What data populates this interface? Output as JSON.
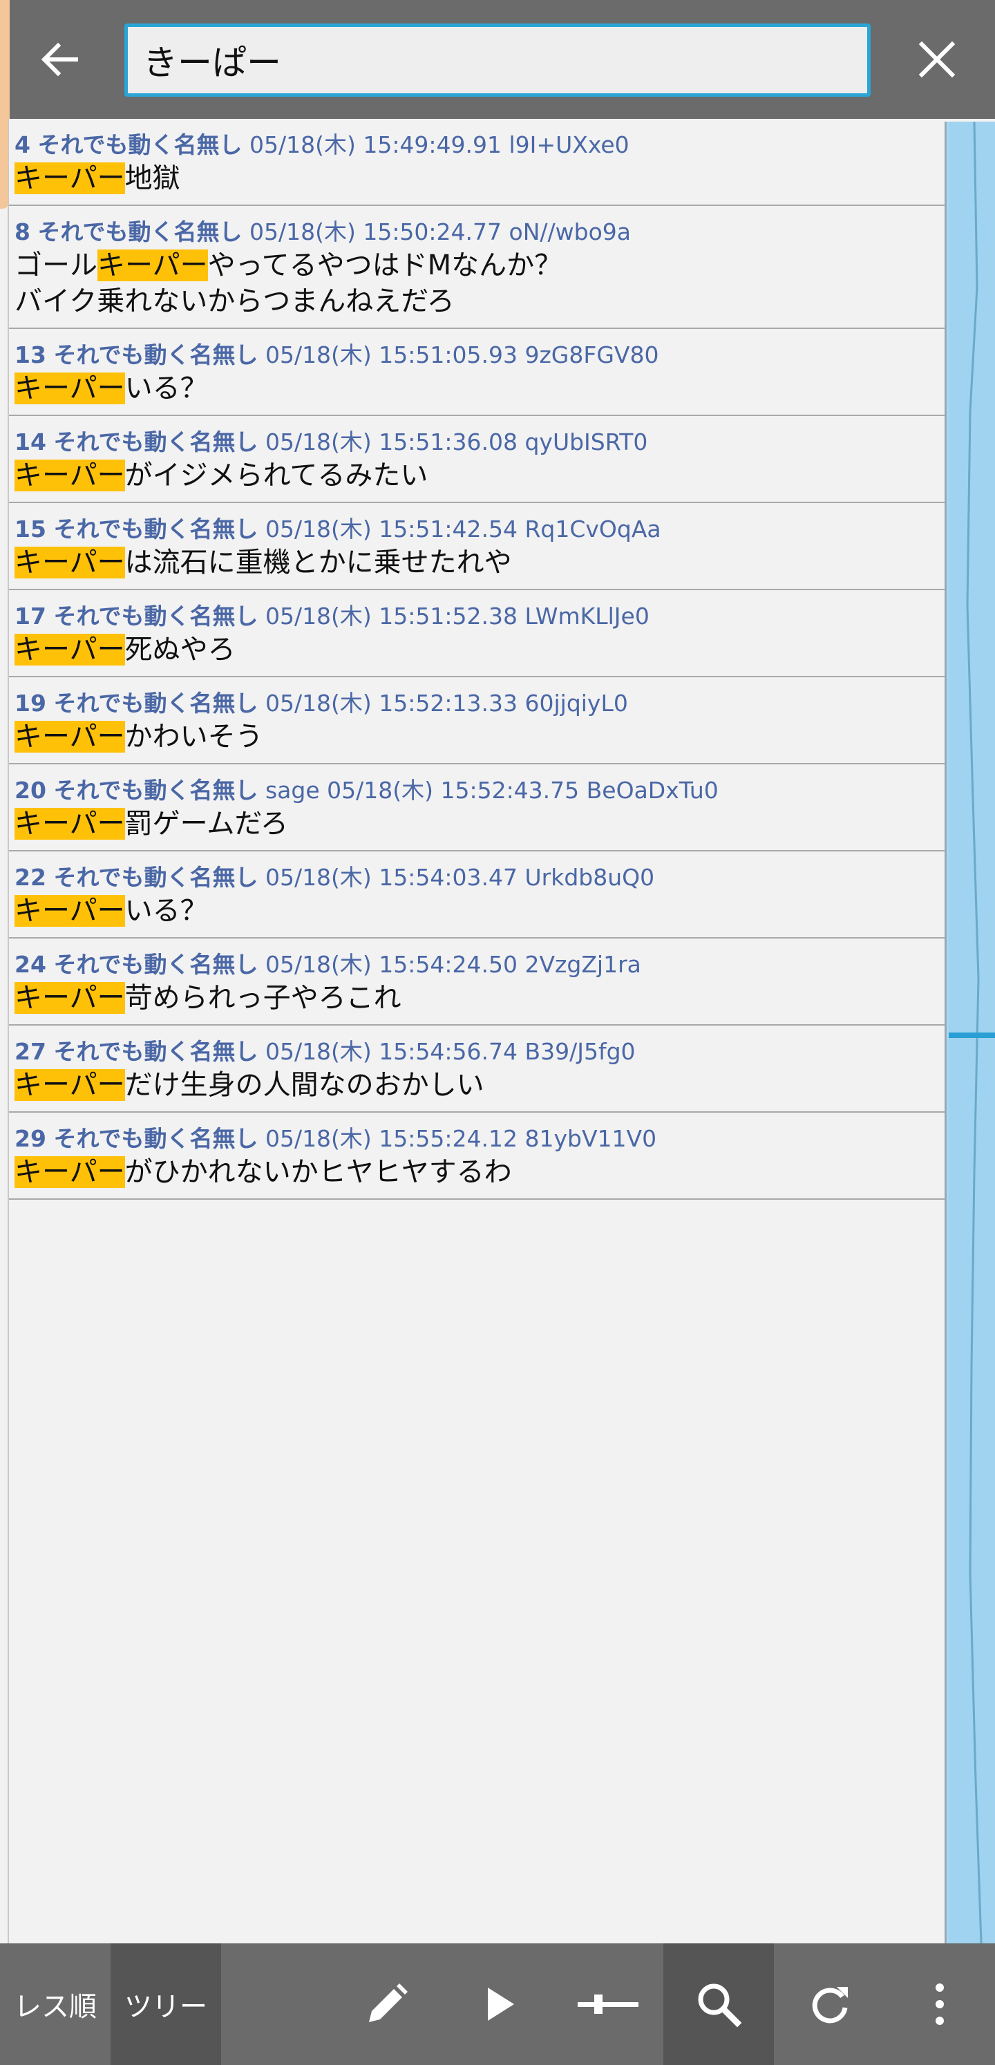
{
  "search": {
    "query": "きーぱー"
  },
  "highlight_term": "キーパー",
  "posts": [
    {
      "num": "4",
      "name": "それでも動く名無し",
      "mail": "",
      "datetime": "05/18(木) 15:49:49.91",
      "id": "l9I+UXxe0",
      "lines": [
        [
          {
            "t": "キーパー",
            "hl": true
          },
          {
            "t": "地獄",
            "hl": false
          }
        ]
      ]
    },
    {
      "num": "8",
      "name": "それでも動く名無し",
      "mail": "",
      "datetime": "05/18(木) 15:50:24.77",
      "id": "oN//wbo9a",
      "lines": [
        [
          {
            "t": "ゴール",
            "hl": false
          },
          {
            "t": "キーパー",
            "hl": true
          },
          {
            "t": "やってるやつはドMなんか？",
            "hl": false
          }
        ],
        [
          {
            "t": "バイク乗れないからつまんねえだろ",
            "hl": false
          }
        ]
      ]
    },
    {
      "num": "13",
      "name": "それでも動く名無し",
      "mail": "",
      "datetime": "05/18(木) 15:51:05.93",
      "id": "9zG8FGV80",
      "lines": [
        [
          {
            "t": "キーパー",
            "hl": true
          },
          {
            "t": "いる？",
            "hl": false
          }
        ]
      ]
    },
    {
      "num": "14",
      "name": "それでも動く名無し",
      "mail": "",
      "datetime": "05/18(木) 15:51:36.08",
      "id": "qyUbISRT0",
      "lines": [
        [
          {
            "t": "キーパー",
            "hl": true
          },
          {
            "t": "がイジメられてるみたい",
            "hl": false
          }
        ]
      ]
    },
    {
      "num": "15",
      "name": "それでも動く名無し",
      "mail": "",
      "datetime": "05/18(木) 15:51:42.54",
      "id": "Rq1CvOqAa",
      "lines": [
        [
          {
            "t": "キーパー",
            "hl": true
          },
          {
            "t": "は流石に重機とかに乗せたれや",
            "hl": false
          }
        ]
      ]
    },
    {
      "num": "17",
      "name": "それでも動く名無し",
      "mail": "",
      "datetime": "05/18(木) 15:51:52.38",
      "id": "LWmKLlJe0",
      "lines": [
        [
          {
            "t": "キーパー",
            "hl": true
          },
          {
            "t": "死ぬやろ",
            "hl": false
          }
        ]
      ]
    },
    {
      "num": "19",
      "name": "それでも動く名無し",
      "mail": "",
      "datetime": "05/18(木) 15:52:13.33",
      "id": "60jjqiyL0",
      "lines": [
        [
          {
            "t": "キーパー",
            "hl": true
          },
          {
            "t": "かわいそう",
            "hl": false
          }
        ]
      ]
    },
    {
      "num": "20",
      "name": "それでも動く名無し",
      "mail": "sage",
      "datetime": "05/18(木) 15:52:43.75",
      "id": "BeOaDxTu0",
      "lines": [
        [
          {
            "t": "キーパー",
            "hl": true
          },
          {
            "t": "罰ゲームだろ",
            "hl": false
          }
        ]
      ]
    },
    {
      "num": "22",
      "name": "それでも動く名無し",
      "mail": "",
      "datetime": "05/18(木) 15:54:03.47",
      "id": "Urkdb8uQ0",
      "lines": [
        [
          {
            "t": "キーパー",
            "hl": true
          },
          {
            "t": "いる？",
            "hl": false
          }
        ]
      ]
    },
    {
      "num": "24",
      "name": "それでも動く名無し",
      "mail": "",
      "datetime": "05/18(木) 15:54:24.50",
      "id": "2VzgZj1ra",
      "lines": [
        [
          {
            "t": "キーパー",
            "hl": true
          },
          {
            "t": "苛められっ子やろこれ",
            "hl": false
          }
        ]
      ]
    },
    {
      "num": "27",
      "name": "それでも動く名無し",
      "mail": "",
      "datetime": "05/18(木) 15:54:56.74",
      "id": "B39/J5fg0",
      "lines": [
        [
          {
            "t": "キーパー",
            "hl": true
          },
          {
            "t": "だけ生身の人間なのおかしい",
            "hl": false
          }
        ]
      ]
    },
    {
      "num": "29",
      "name": "それでも動く名無し",
      "mail": "",
      "datetime": "05/18(木) 15:55:24.12",
      "id": "81ybV11V0",
      "lines": [
        [
          {
            "t": "キーパー",
            "hl": true
          },
          {
            "t": "がひかれないかヒヤヒヤするわ",
            "hl": false
          }
        ]
      ]
    }
  ],
  "bottom_tabs": [
    {
      "label": "レス順",
      "active": false
    },
    {
      "label": "ツリー",
      "active": true
    }
  ],
  "toolbar_icons": [
    "pencil-icon",
    "play-icon",
    "slider-icon",
    "search-icon",
    "refresh-icon",
    "more-vertical-icon"
  ],
  "colors": {
    "bar": "#6b6b6b",
    "search_border": "#2aa5d6",
    "highlight": "#ffc107",
    "header_text": "#4a67a6",
    "minimap": "#a9d9f1",
    "accent": "#f3c79a"
  }
}
